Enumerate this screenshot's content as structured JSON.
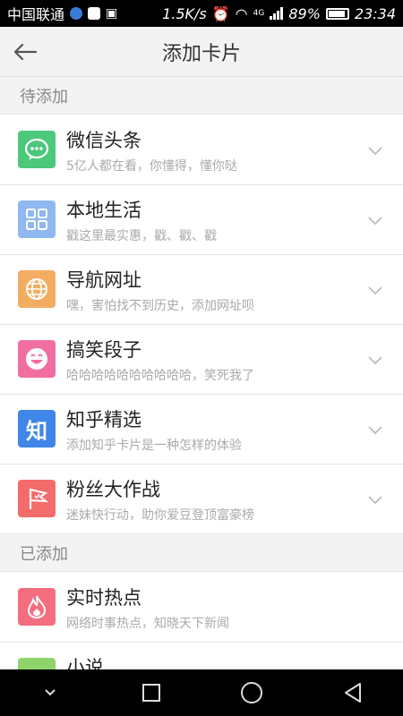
{
  "status_bar": {
    "carrier": "中国联通",
    "speed": "1.5K/s",
    "network": "4G",
    "battery": "89%",
    "time": "23:34"
  },
  "header": {
    "title": "添加卡片",
    "back_icon": "back-arrow-icon"
  },
  "sections": [
    {
      "label": "待添加"
    },
    {
      "label": "已添加"
    }
  ],
  "pending_cards": [
    {
      "name": "微信头条",
      "desc": "5亿人都在看，你懂得，懂你哒",
      "icon": "wechat-icon",
      "color": "#4cc87b"
    },
    {
      "name": "本地生活",
      "desc": "戳这里最实惠，戳、戳、戳",
      "icon": "grid-icon",
      "color": "#8fb8f0"
    },
    {
      "name": "导航网址",
      "desc": "嘿，害怕找不到历史，添加网址呗",
      "icon": "globe-icon",
      "color": "#f3ad62"
    },
    {
      "name": "搞笑段子",
      "desc": "哈哈哈哈哈哈哈哈哈哈，笑死我了",
      "icon": "smile-icon",
      "color": "#f06fa0"
    },
    {
      "name": "知乎精选",
      "desc": "添加知乎卡片是一种怎样的体验",
      "icon": "zhihu-icon",
      "icon_text": "知",
      "color": "#3f86e8"
    },
    {
      "name": "粉丝大作战",
      "desc": "迷妹快行动，助你爱豆登顶富豪榜",
      "icon": "flag-icon",
      "color": "#f36b6b"
    }
  ],
  "added_cards": [
    {
      "name": "实时热点",
      "desc": "网络时事热点，知晓天下新闻",
      "icon": "flame-icon",
      "color": "#f36f7f"
    },
    {
      "name": "小说",
      "desc": "",
      "icon": "book-icon",
      "color": "#8fd46b"
    }
  ],
  "nav_bar": {
    "buttons": [
      "chevron-down-icon",
      "square-icon",
      "circle-icon",
      "triangle-back-icon"
    ]
  }
}
